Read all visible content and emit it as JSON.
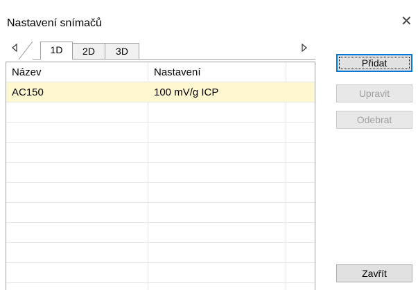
{
  "window": {
    "title": "Nastavení snímačů"
  },
  "tabs": [
    "1D",
    "2D",
    "3D"
  ],
  "table": {
    "headers": [
      "Název",
      "Nastavení"
    ],
    "rows": [
      [
        "AC150",
        "100 mV/g ICP"
      ]
    ]
  },
  "buttons": {
    "add": "Přidat",
    "edit": "Upravit",
    "remove": "Odebrat",
    "close": "Zavřít"
  },
  "icons": {
    "close": "close-icon",
    "scroll_left": "triangle-left-icon",
    "scroll_right": "triangle-right-icon"
  },
  "colors": {
    "selected_row": "#fff7d0",
    "default_button_border": "#0078d7"
  }
}
